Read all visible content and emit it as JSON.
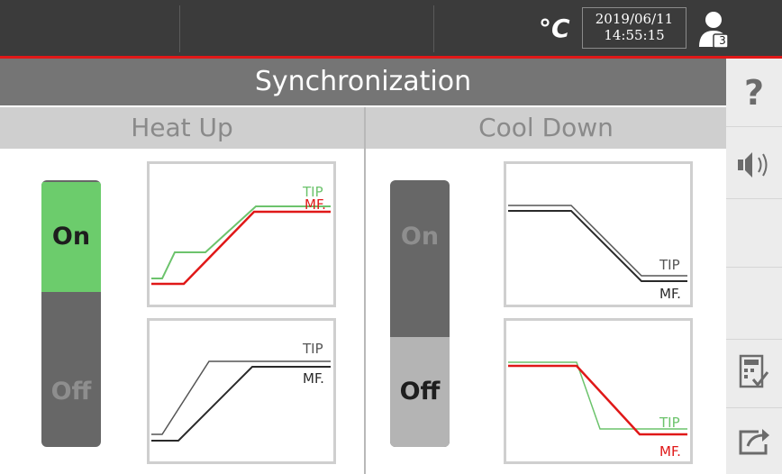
{
  "status_bar": {
    "temperature_unit": "°C",
    "date": "2019/06/11",
    "time": "14:55:15",
    "user_level": "3"
  },
  "title": "Synchronization",
  "heat_up": {
    "header": "Heat Up",
    "toggle": {
      "on_label": "On",
      "off_label": "Off",
      "state": "On"
    },
    "graph_synced": {
      "tip_label": "TIP",
      "mf_label": "MF.",
      "tip_color": "#6cc36c",
      "mf_color": "#e01818"
    },
    "graph_unsynced": {
      "tip_label": "TIP",
      "mf_label": "MF.",
      "tip_color": "#555555",
      "mf_color": "#2a2a2a"
    }
  },
  "cool_down": {
    "header": "Cool Down",
    "toggle": {
      "on_label": "On",
      "off_label": "Off",
      "state": "Off"
    },
    "graph_unsynced": {
      "tip_label": "TIP",
      "mf_label": "MF.",
      "tip_color": "#555555",
      "mf_color": "#2a2a2a"
    },
    "graph_synced": {
      "tip_label": "TIP",
      "mf_label": "MF.",
      "tip_color": "#6cc36c",
      "mf_color": "#e01818"
    }
  },
  "sidebar": {
    "items": [
      {
        "icon": "help-icon",
        "glyph": "?"
      },
      {
        "icon": "speaker-icon"
      },
      {
        "icon": "empty"
      },
      {
        "icon": "empty"
      },
      {
        "icon": "calculator-check-icon"
      },
      {
        "icon": "export-icon"
      }
    ]
  },
  "colors": {
    "accent_red": "#e01818",
    "active_green": "#6ccc6c",
    "title_gray": "#757575"
  }
}
